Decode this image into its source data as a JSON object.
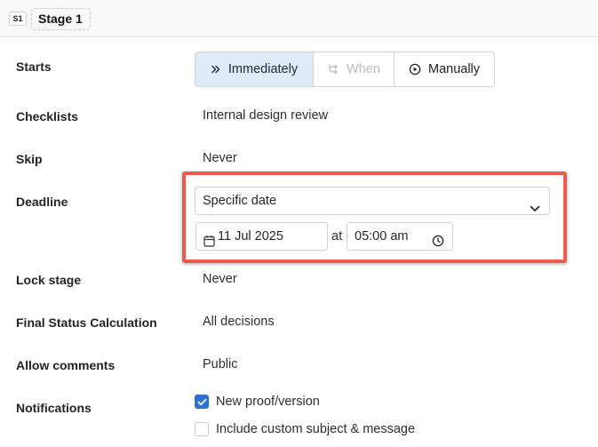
{
  "stage": {
    "badge": "S1",
    "title": "Stage 1"
  },
  "starts": {
    "label": "Starts",
    "options": [
      {
        "label": "Immediately",
        "icon": "double-chevron-right-icon",
        "state": "active"
      },
      {
        "label": "When",
        "icon": "branch-icon",
        "state": "disabled"
      },
      {
        "label": "Manually",
        "icon": "play-circle-icon",
        "state": "normal"
      }
    ]
  },
  "checklists": {
    "label": "Checklists",
    "value": "Internal design review"
  },
  "skip": {
    "label": "Skip",
    "value": "Never"
  },
  "deadline": {
    "label": "Deadline",
    "select_value": "Specific date",
    "date": "11 Jul 2025",
    "at": "at",
    "time": "05:00 am"
  },
  "lock_stage": {
    "label": "Lock stage",
    "value": "Never"
  },
  "final_status": {
    "label": "Final Status Calculation",
    "value": "All decisions"
  },
  "allow_comments": {
    "label": "Allow comments",
    "value": "Public"
  },
  "notifications": {
    "label": "Notifications",
    "options": [
      {
        "label": "New proof/version",
        "checked": true
      },
      {
        "label": "Include custom subject & message",
        "checked": false
      }
    ]
  },
  "colors": {
    "accent": "#2f6fd6",
    "active_bg": "#deebf9",
    "highlight": "#ef5a4f"
  }
}
